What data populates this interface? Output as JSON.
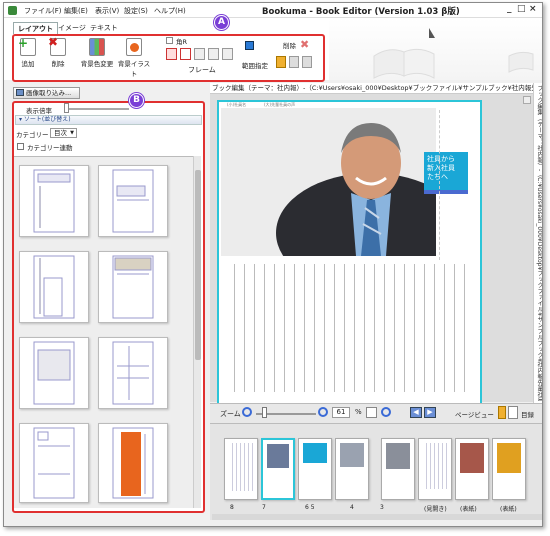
{
  "titlebar": {
    "menus": [
      "ファイル(F)",
      "編集(E)",
      "表示(V)",
      "設定(S)",
      "ヘルプ(H)"
    ],
    "title": "Bookuma - Book Editor (Version 1.03 β版)",
    "controls": [
      "_",
      "□",
      "×"
    ]
  },
  "ribbon": {
    "tabs": [
      "レイアウト",
      "イメージ",
      "テキスト"
    ],
    "buttons": {
      "add": "追加",
      "delete": "削除",
      "bg_color": "背景色変更",
      "bg_illust": "背景イラスト",
      "frame": "フレーム",
      "corner_r": "角R",
      "range": "範囲指定",
      "remove": "削除"
    }
  },
  "badges": {
    "a": "A",
    "b": "B"
  },
  "leftpanel": {
    "load_button": "画像取り込み...",
    "zoom_label": "表示倍率",
    "sort_header": "ソート(並び替え)",
    "category_label": "カテゴリー",
    "category_value": "目次",
    "category_link_label": "カテゴリー連動"
  },
  "editor": {
    "path": "ブック編集（テーマ：社内報）-（C:¥Users¥osaki_000¥Desktop¥ブックファイル¥サンプルブック¥社内報先輩社員の声.xbml）",
    "headline_lines": [
      "社員から",
      "新入社員",
      "たちへ"
    ],
    "small_labels": [
      "(小)社員名",
      "(大)先輩社員の声"
    ],
    "side_path": "ブック編集（テーマ：社内報）-（C:¥Users¥osaki_000¥Desktop¥ブックファイル¥サンプルブック¥社内報先輩社員の声.xbml）"
  },
  "zoombar": {
    "zoom_label": "ズーム",
    "zoom_value": "61",
    "percent": "%",
    "pageview_label": "ページビュー",
    "direction_label": "目録"
  },
  "filmstrip": {
    "labels": [
      "8",
      "7",
      "6 5",
      "4",
      "3",
      "(見開き)",
      "(表紙)",
      "(表紙)"
    ]
  },
  "colors": {
    "accent_red": "#e03030",
    "badge": "#7a3fd6",
    "cyan": "#2cc5d8",
    "orange": "#e8651e"
  }
}
